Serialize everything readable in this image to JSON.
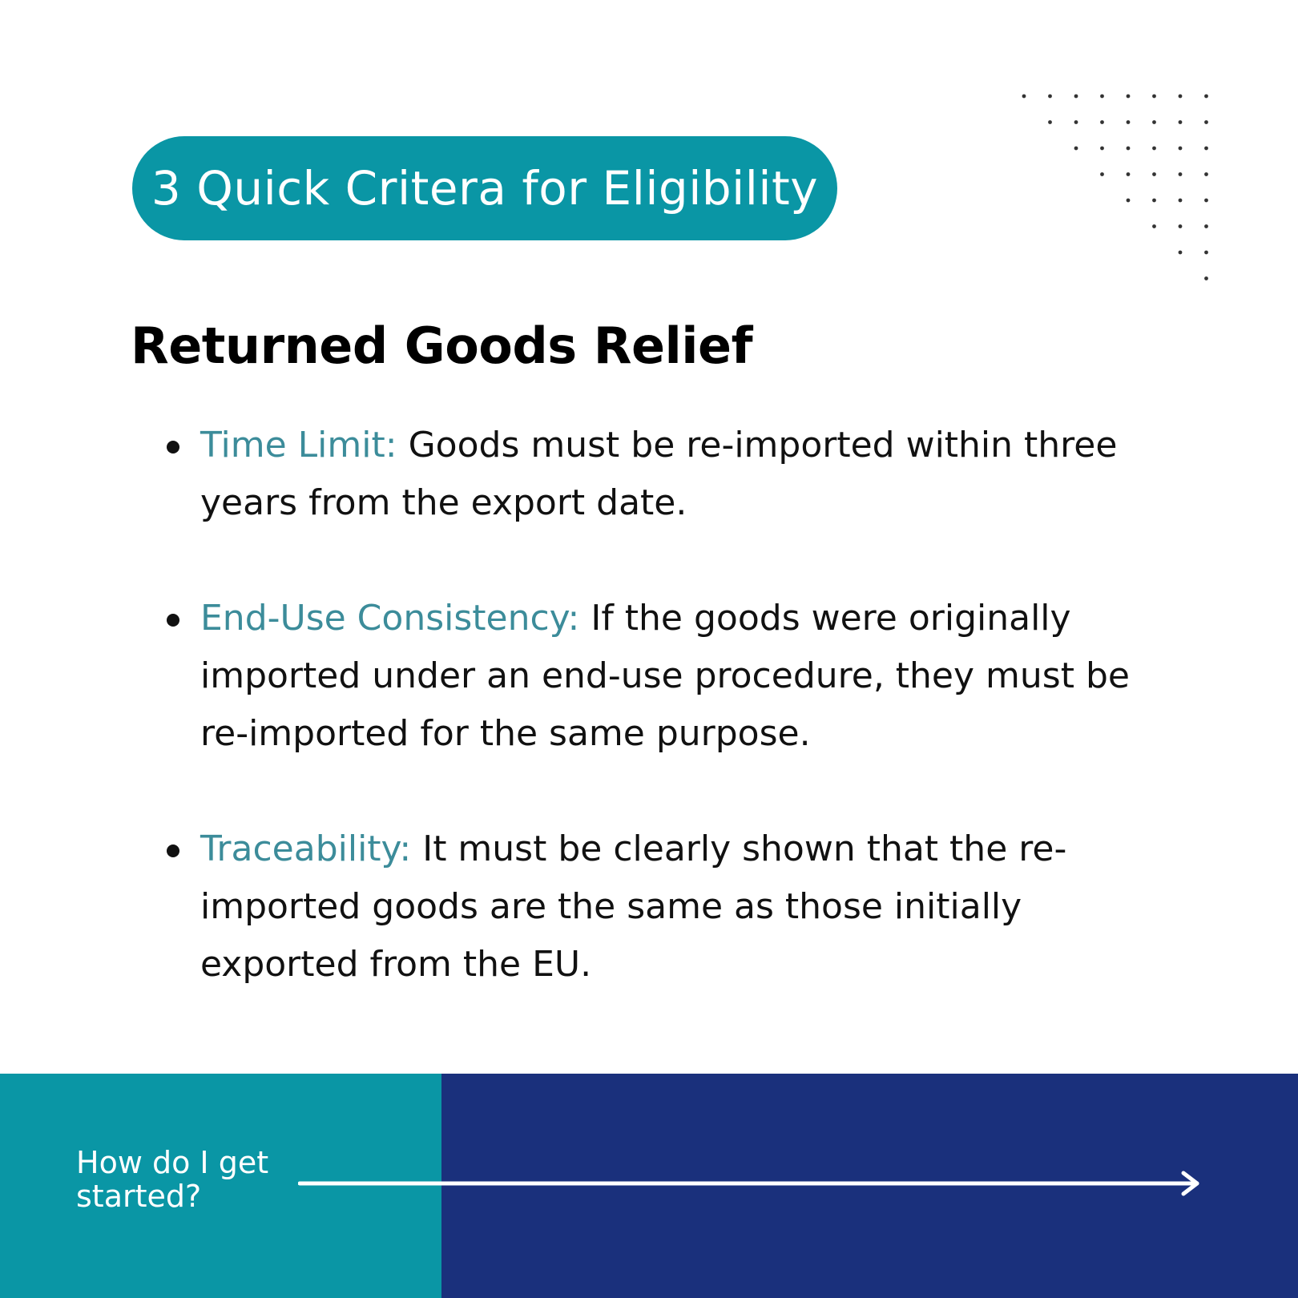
{
  "header": {
    "badge_text": "3 Quick Critera for Eligibility"
  },
  "section": {
    "title": "Returned Goods Relief"
  },
  "criteria": [
    {
      "term": "Time Limit:",
      "text": "Goods must be re-imported within three years from the export date."
    },
    {
      "term": "End-Use Consistency:",
      "text": "If the goods were originally imported under an end-use procedure, they must be re-imported for the same purpose."
    },
    {
      "term": "Traceability:",
      "text": "It must be clearly shown that the re-imported goods are the same as those initially exported from the EU."
    }
  ],
  "footer": {
    "cta_text": "How do I get started?"
  },
  "icons": {
    "decoration": "dot-grid-icon",
    "navigation": "arrow-right-icon"
  },
  "colors": {
    "teal": "#0a96a5",
    "navy": "#1a307c",
    "term_teal": "#3c8c9a",
    "text": "#111111"
  }
}
